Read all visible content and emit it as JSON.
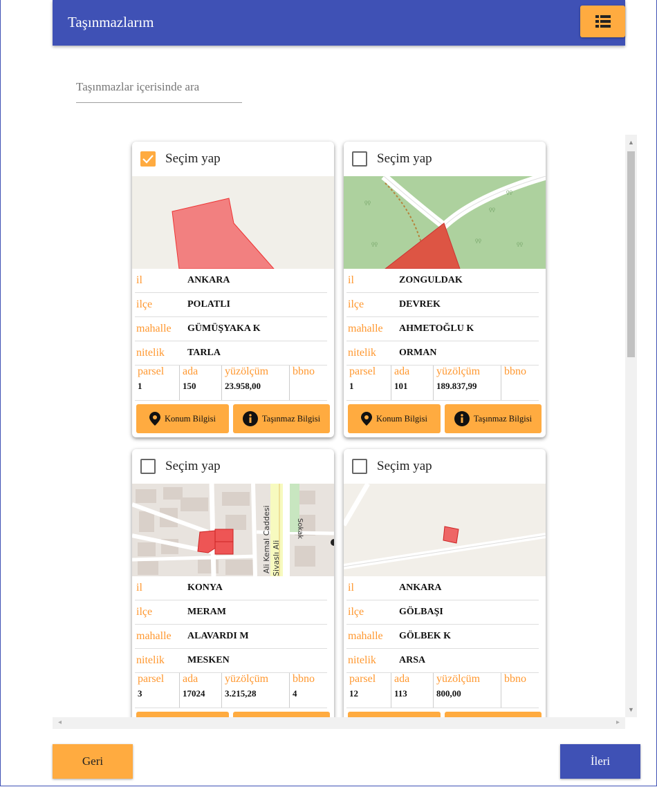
{
  "header": {
    "title": "Taşınmazlarım",
    "list_icon": "list-icon"
  },
  "search": {
    "placeholder": "Taşınmazlar içerisinde ara"
  },
  "labels": {
    "select": "Seçim yap",
    "il": "il",
    "ilce": "ilçe",
    "mahalle": "mahalle",
    "nitelik": "nitelik",
    "parsel": "parsel",
    "ada": "ada",
    "yuzolcum": "yüzölçüm",
    "bbno": "bbno",
    "konum_btn": "Konum Bilgisi",
    "tasinmaz_btn": "Taşınmaz Bilgisi"
  },
  "colors": {
    "primary": "#3f51b5",
    "accent": "#ffab40",
    "label": "#ff9830"
  },
  "cards": [
    {
      "checked": true,
      "il": "ANKARA",
      "ilce": "POLATLI",
      "mahalle": "GÜMÜŞYAKA K",
      "nitelik": "TARLA",
      "parsel": "1",
      "ada": "150",
      "yuzolcum": "23.958,00",
      "bbno": ""
    },
    {
      "checked": false,
      "il": "ZONGULDAK",
      "ilce": "DEVREK",
      "mahalle": "AHMETOĞLU K",
      "nitelik": "ORMAN",
      "parsel": "1",
      "ada": "101",
      "yuzolcum": "189.837,99",
      "bbno": ""
    },
    {
      "checked": false,
      "il": "KONYA",
      "ilce": "MERAM",
      "mahalle": "ALAVARDI M",
      "nitelik": "MESKEN",
      "parsel": "3",
      "ada": "17024",
      "yuzolcum": "3.215,28",
      "bbno": "4"
    },
    {
      "checked": false,
      "il": "ANKARA",
      "ilce": "GÖLBAŞI",
      "mahalle": "GÖLBEK K",
      "nitelik": "ARSA",
      "parsel": "12",
      "ada": "113",
      "yuzolcum": "800,00",
      "bbno": ""
    }
  ],
  "maps": {
    "konya_street_1": "Ali Kemal Caddesi",
    "konya_street_2": "Sivaslı Ali",
    "konya_street_3": "Sokak"
  },
  "nav": {
    "back": "Geri",
    "next": "İleri"
  }
}
